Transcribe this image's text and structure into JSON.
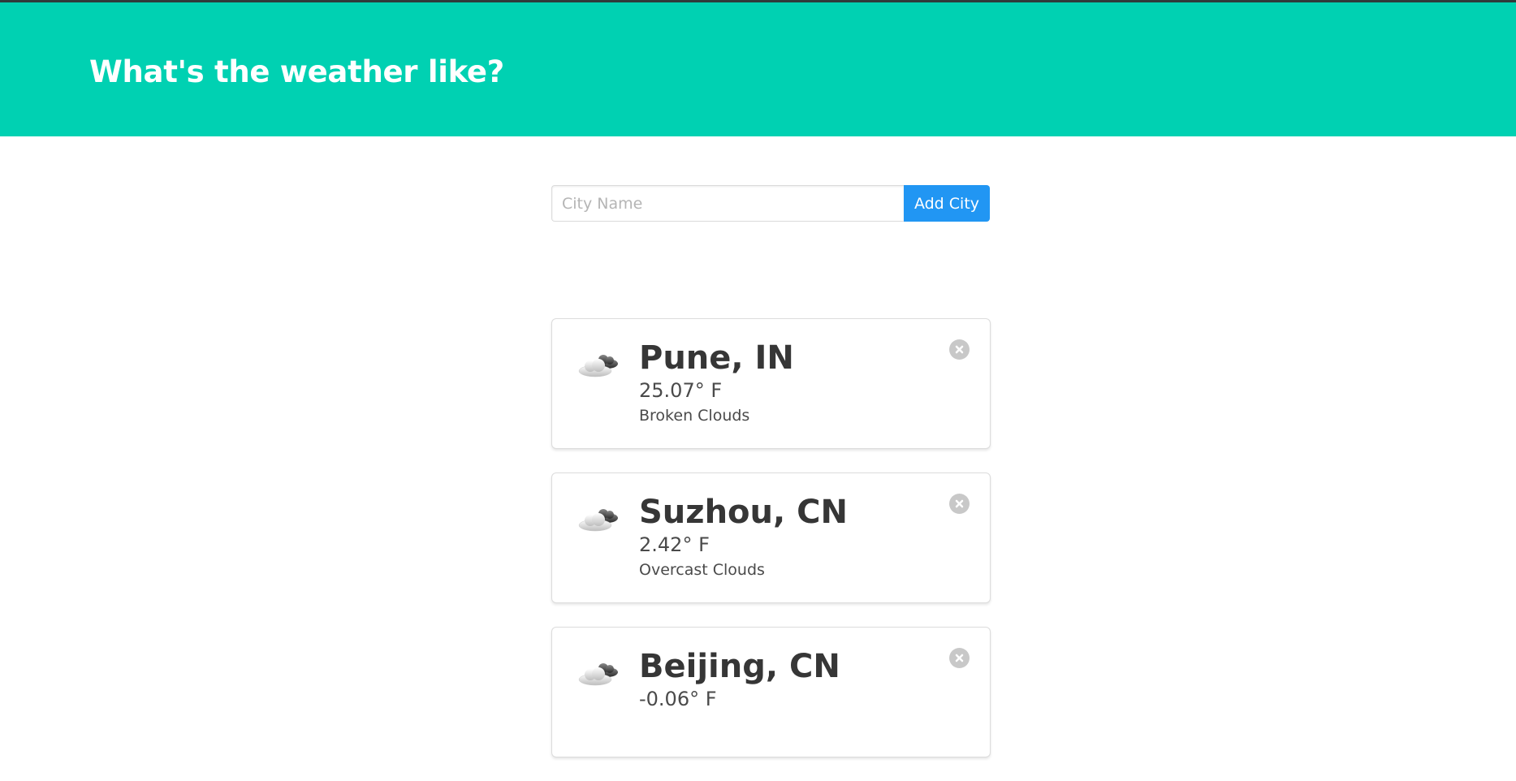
{
  "header": {
    "title": "What's the weather like?"
  },
  "search": {
    "placeholder": "City Name",
    "value": "",
    "button_label": "Add City"
  },
  "cities": [
    {
      "name": "Pune, IN",
      "temperature": "25.07° F",
      "description": "Broken Clouds",
      "icon": "broken-clouds-icon"
    },
    {
      "name": "Suzhou, CN",
      "temperature": "2.42° F",
      "description": "Overcast Clouds",
      "icon": "overcast-clouds-icon"
    },
    {
      "name": "Beijing, CN",
      "temperature": "-0.06° F",
      "description": "",
      "icon": "broken-clouds-icon"
    }
  ],
  "colors": {
    "header_bg": "#00d1b2",
    "button_bg": "#2196f3",
    "delete_bg": "#c8c8c8"
  }
}
